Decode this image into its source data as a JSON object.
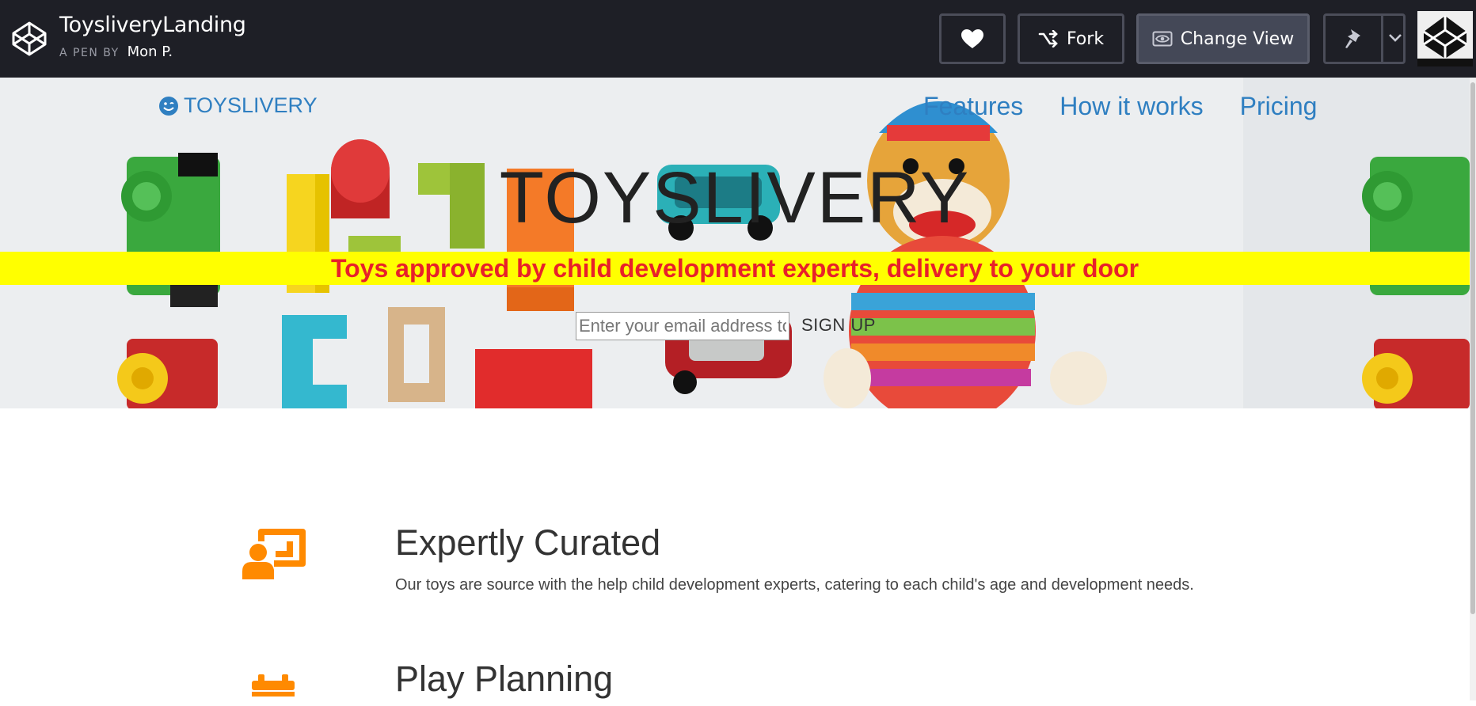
{
  "codepen": {
    "pen_title": "ToysliveryLanding",
    "byline_prefix": "A PEN BY",
    "author": "Mon P.",
    "fork_label": "Fork",
    "change_view_label": "Change View",
    "icons": [
      "codepen-logo-icon",
      "heart-icon",
      "fork-icon",
      "eye-icon",
      "pin-icon",
      "chevron-down-icon"
    ]
  },
  "site": {
    "brand": "TOYSLIVERY",
    "nav": [
      "Features",
      "How it works",
      "Pricing"
    ],
    "hero_title": "TOYSLIVERY",
    "tagline": "Toys approved by child development experts, delivery to your door",
    "email_placeholder": "Enter your email address to l",
    "signup_label": "SIGN UP",
    "features": [
      {
        "title": "Expertly Curated",
        "description": "Our toys are source with the help child development experts, catering to each child's age and development needs.",
        "icon": "teacher-board-icon"
      },
      {
        "title": "Play Planning",
        "description": "",
        "icon": "calendar-icon"
      }
    ]
  },
  "colors": {
    "codepen_bar": "#1e1f26",
    "link_blue": "#2f7fc1",
    "tagline_bg": "#ffff00",
    "tagline_text": "#e8202a",
    "feature_icon": "#ff8a00"
  }
}
